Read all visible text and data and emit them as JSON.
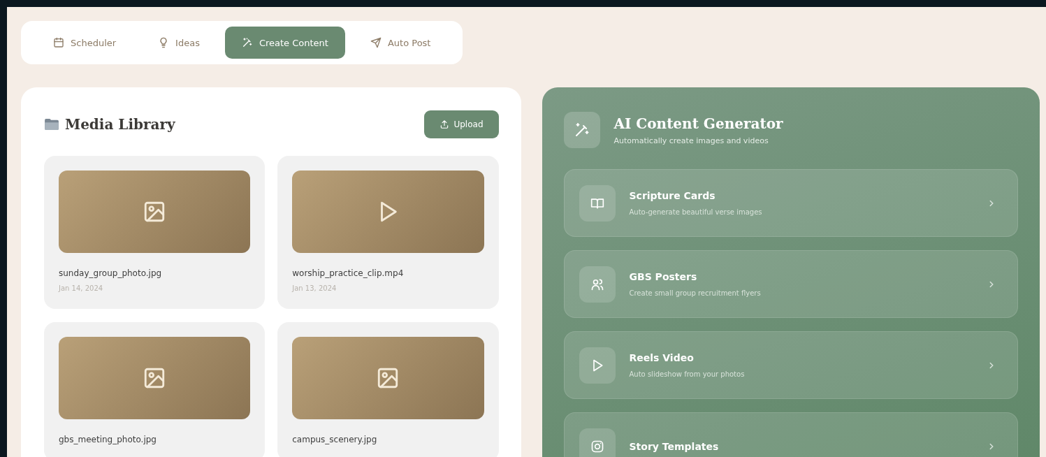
{
  "tabs": [
    {
      "label": "Scheduler",
      "selected": false
    },
    {
      "label": "Ideas",
      "selected": false
    },
    {
      "label": "Create Content",
      "selected": true
    },
    {
      "label": "Auto Post",
      "selected": false
    }
  ],
  "media_library": {
    "title": "Media Library",
    "upload_button": "Upload",
    "items": [
      {
        "kind": "image",
        "name": "sunday_group_photo.jpg",
        "date": "Jan 14, 2024"
      },
      {
        "kind": "video",
        "name": "worship_practice_clip.mp4",
        "date": "Jan 13, 2024"
      },
      {
        "kind": "image",
        "name": "gbs_meeting_photo.jpg"
      },
      {
        "kind": "image",
        "name": "campus_scenery.jpg"
      }
    ]
  },
  "generator": {
    "title": "AI Content Generator",
    "subtitle": "Automatically create images and videos",
    "items": [
      {
        "title": "Scripture Cards",
        "description": "Auto-generate beautiful verse images"
      },
      {
        "title": "GBS Posters",
        "description": "Create small group recruitment flyers"
      },
      {
        "title": "Reels Video",
        "description": "Auto slideshow from your photos"
      },
      {
        "title": "Story Templates"
      }
    ]
  }
}
